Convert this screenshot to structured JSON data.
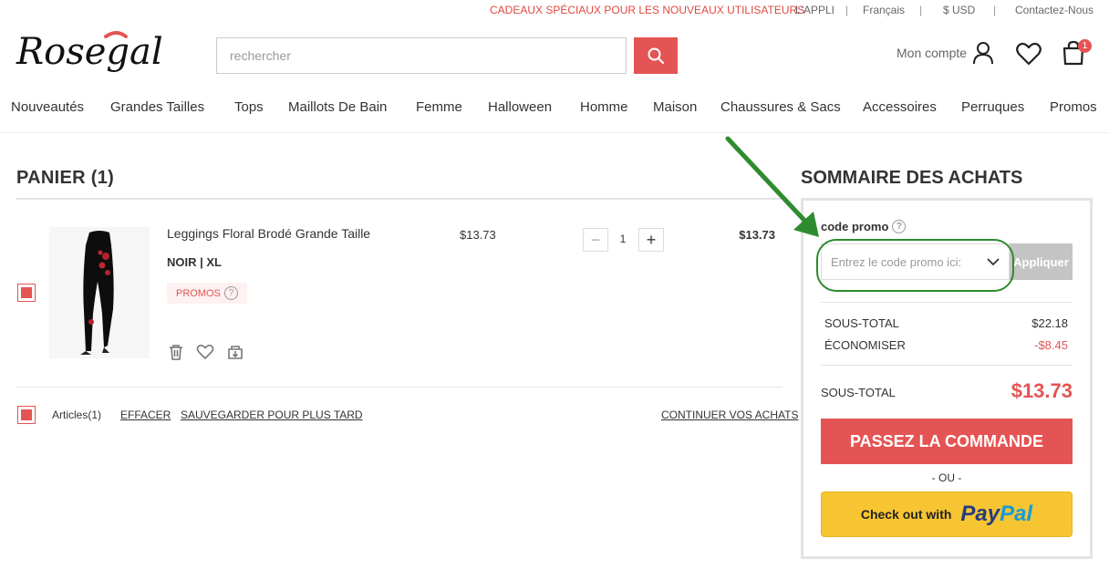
{
  "topbar": {
    "promo": "CADEAUX SPÉCIAUX POUR LES NOUVEAUX UTILISATEURS",
    "app": "L'APPLI",
    "language": "Français",
    "currency": "$ USD",
    "contact": "Contactez-Nous",
    "separator": "|"
  },
  "header": {
    "logo_text": "Rosegal",
    "search_placeholder": "rechercher",
    "account_label": "Mon compte",
    "bag_count": "1"
  },
  "nav": {
    "items": [
      "Nouveautés",
      "Grandes Tailles",
      "Tops",
      "Maillots De Bain",
      "Femme",
      "Halloween",
      "Homme",
      "Maison",
      "Chaussures & Sacs",
      "Accessoires",
      "Perruques",
      "Promos"
    ]
  },
  "cart": {
    "title": "PANIER (1)",
    "item": {
      "name": "Leggings Floral Brodé Grande Taille",
      "variant": "NOIR | XL",
      "tag": "PROMOS",
      "tag_help": "?",
      "unit_price": "$13.73",
      "quantity": "1",
      "qty_minus": "−",
      "qty_plus": "+",
      "total_price": "$13.73"
    },
    "footer": {
      "articles": "Articles(1)",
      "clear": "EFFACER",
      "save_later": "SAUVEGARDER POUR PLUS TARD",
      "continue": "CONTINUER VOS ACHATS"
    }
  },
  "summary": {
    "title": "SOMMAIRE DES ACHATS",
    "promo_label": "code promo",
    "promo_help": "?",
    "promo_placeholder": "Entrez le code promo ici:",
    "apply": "Appliquer",
    "subtotal_label": "SOUS-TOTAL",
    "subtotal_value": "$22.18",
    "savings_label": "ÉCONOMISER",
    "savings_value": "-$8.45",
    "total_label": "SOUS-TOTAL",
    "total_value": "$13.73",
    "order_button": "PASSEZ LA COMMANDE",
    "or": "- OU -",
    "paypal_prefix": "Check out with",
    "paypal_pay": "Pay",
    "paypal_pal": "Pal"
  },
  "colors": {
    "accent": "#e55454",
    "annotation": "#2e8b2e",
    "paypal_yellow": "#f7c531"
  }
}
